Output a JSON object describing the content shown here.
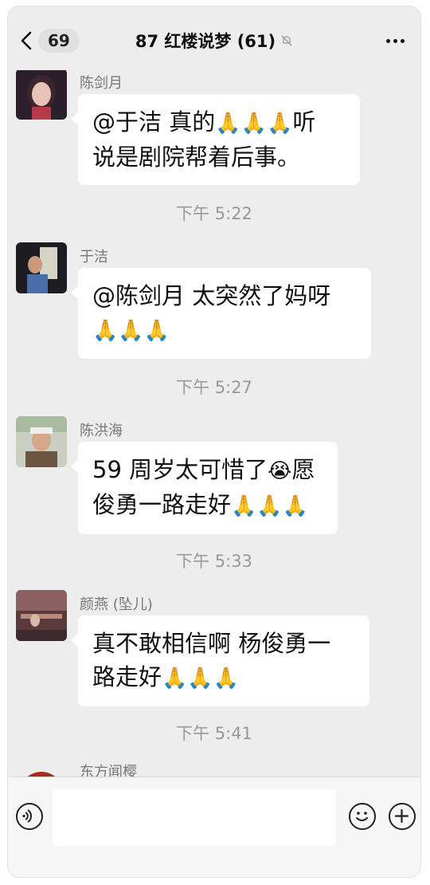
{
  "header": {
    "back_count": "69",
    "title": "87 红楼说梦 (61)"
  },
  "icons": {
    "back": "chevron-left-icon",
    "mute": "bell-off-icon",
    "more": "more-dots-icon",
    "voice": "voice-icon",
    "emoji": "emoji-icon",
    "add": "plus-icon"
  },
  "messages": [
    {
      "sender": "陈剑月",
      "lines": [
        [
          "@于洁 真的",
          "🙏🙏🙏",
          "听"
        ],
        [
          "说是剧院帮着后事。"
        ]
      ]
    },
    {
      "timestamp": "下午 5:22"
    },
    {
      "sender": "于洁",
      "lines": [
        [
          "@陈剑月 太突然了妈呀"
        ],
        [
          "🙏🙏🙏"
        ]
      ]
    },
    {
      "timestamp": "下午 5:27"
    },
    {
      "sender": "陈洪海",
      "lines": [
        [
          "59 周岁太可惜了",
          "😭",
          "愿"
        ],
        [
          "俊勇一路走好",
          "🙏🙏🙏"
        ]
      ]
    },
    {
      "timestamp": "下午 5:33"
    },
    {
      "sender": "颜燕 (坠儿)",
      "lines": [
        [
          "真不敢相信啊 杨俊勇一"
        ],
        [
          "路走好",
          "🙏🙏🙏"
        ]
      ]
    },
    {
      "timestamp": "下午 5:41"
    },
    {
      "sender": "东方闻樱"
    }
  ],
  "m1": {
    "sender": "陈剑月",
    "l1a": "@于洁 真的",
    "l1b": "🙏🙏🙏",
    "l1c": "听",
    "l2": "说是剧院帮着后事。"
  },
  "t1": "下午 5:22",
  "m2": {
    "sender": "于洁",
    "l1": "@陈剑月 太突然了妈呀",
    "l2": "🙏🙏🙏"
  },
  "t2": "下午 5:27",
  "m3": {
    "sender": "陈洪海",
    "l1a": "59 周岁太可惜了",
    "l1b": "😭",
    "l1c": "愿",
    "l2a": "俊勇一路走好",
    "l2b": "🙏🙏🙏"
  },
  "t3": "下午 5:33",
  "m4": {
    "sender": "颜燕 (坠儿)",
    "l1": "真不敢相信啊 杨俊勇一",
    "l2a": "路走好",
    "l2b": "🙏🙏🙏"
  },
  "t4": "下午 5:41",
  "m5": {
    "sender": "东方闻樱"
  },
  "input": {
    "value": ""
  }
}
